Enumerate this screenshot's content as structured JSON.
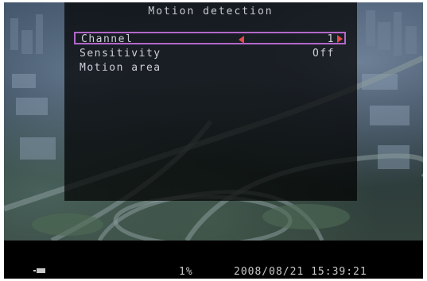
{
  "osd": {
    "title": "Motion detection",
    "menu": [
      {
        "label": "Channel",
        "value": "1",
        "selected": true
      },
      {
        "label": "Sensitivity",
        "value": "Off"
      },
      {
        "label": "Motion area",
        "value": ""
      }
    ]
  },
  "status_bar": {
    "percent": "1%",
    "datetime": "2008/08/21 15:39:21"
  },
  "colors": {
    "selection_border": "#b267c9",
    "arrow": "#e24a4a",
    "osd_text": "#cfcfd8"
  }
}
